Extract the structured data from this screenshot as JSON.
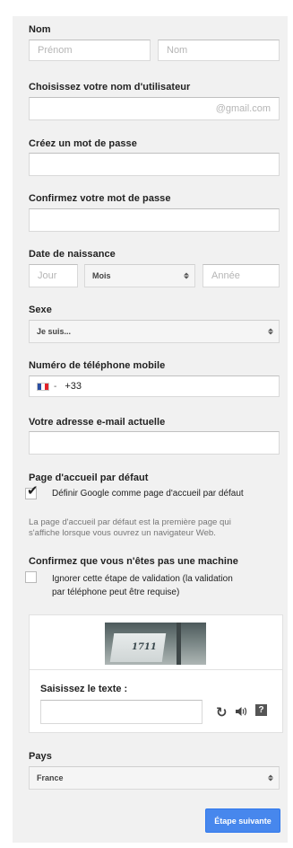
{
  "name_section": {
    "label": "Nom",
    "first_placeholder": "Prénom",
    "last_placeholder": "Nom"
  },
  "username_section": {
    "label": "Choisissez votre nom d'utilisateur",
    "suffix": "@gmail.com"
  },
  "password_section": {
    "label": "Créez un mot de passe"
  },
  "confirm_password_section": {
    "label": "Confirmez votre mot de passe"
  },
  "birth_section": {
    "label": "Date de naissance",
    "day_placeholder": "Jour",
    "month_selected": "Mois",
    "year_placeholder": "Année"
  },
  "gender_section": {
    "label": "Sexe",
    "selected": "Je suis..."
  },
  "phone_section": {
    "label": "Numéro de téléphone mobile",
    "dash": "-",
    "prefix": "+33",
    "flag_colors": [
      "#2a4ea2",
      "#ffffff",
      "#e2232a"
    ]
  },
  "email_section": {
    "label": "Votre adresse e-mail actuelle"
  },
  "homepage_section": {
    "label": "Page d'accueil par défaut",
    "checkbox_label": "Définir Google comme page d'accueil par défaut",
    "checked": true,
    "description_line1": "La page d'accueil par défaut est la première page qui",
    "description_line2": "s'affiche lorsque vous ouvrez un navigateur Web."
  },
  "robot_section": {
    "label": "Confirmez que vous n'êtes pas une machine",
    "checkbox_line1": "Ignorer cette étape de validation (la validation",
    "checkbox_line2": "par téléphone peut être requise)",
    "checked": false
  },
  "captcha": {
    "image_text": "1711",
    "prompt": "Saisissez le texte :",
    "refresh_icon": "refresh-icon",
    "audio_icon": "speaker-icon",
    "help_icon": "help-icon",
    "help_glyph": "?"
  },
  "country_section": {
    "label": "Pays",
    "selected": "France"
  },
  "next_button": {
    "label": "Étape suivante"
  },
  "colors": {
    "accent": "#4787ed",
    "panel_bg": "#f1f1f1"
  }
}
